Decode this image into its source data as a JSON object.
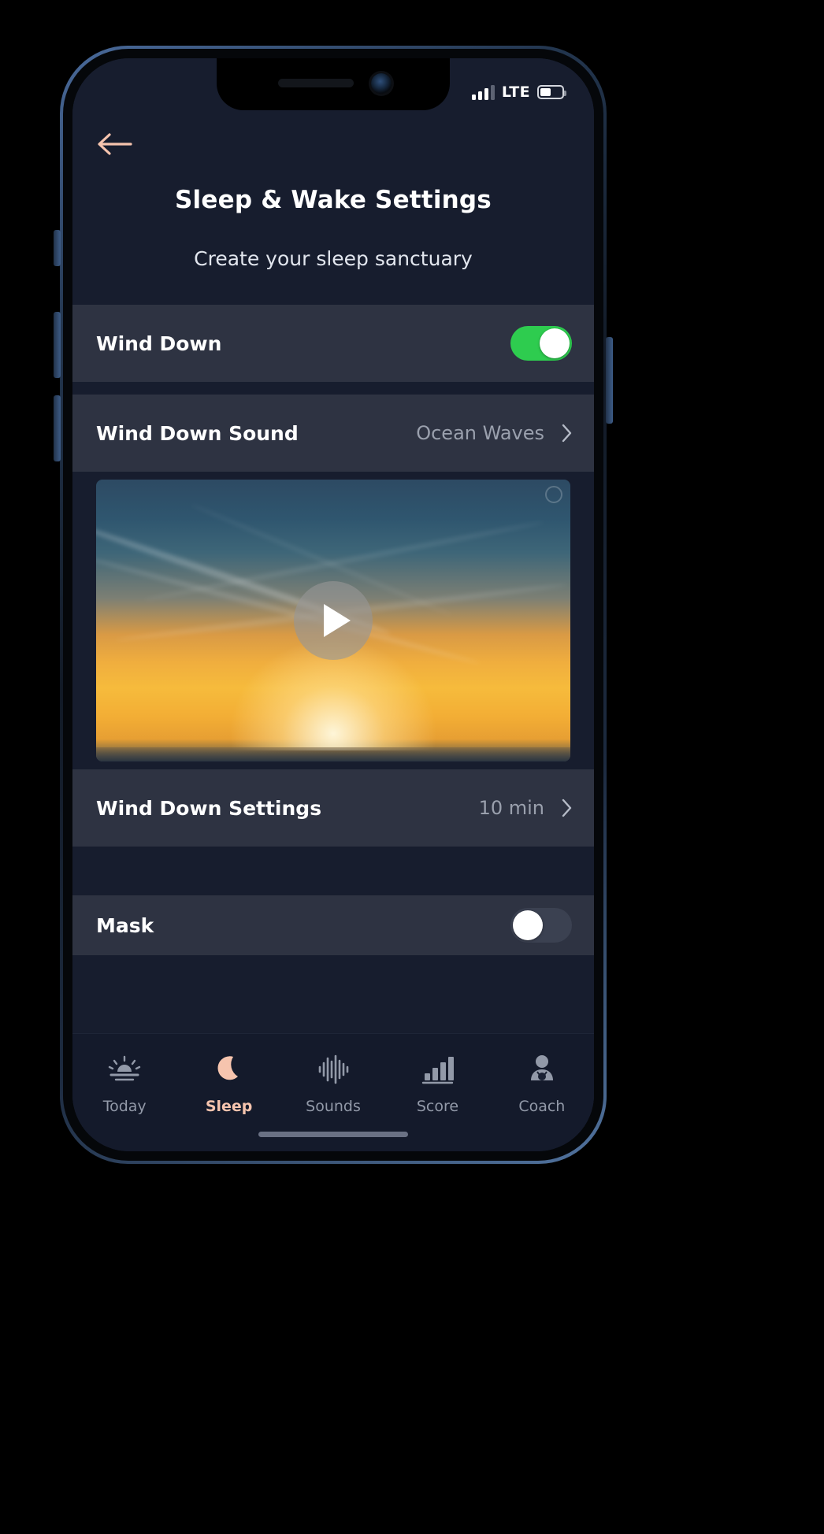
{
  "status_bar": {
    "network": "LTE",
    "signal_bars_filled": 3,
    "signal_bars_total": 4,
    "battery_percent": 50
  },
  "header": {
    "back_icon": "arrow-left-icon",
    "title": "Sleep & Wake Settings",
    "subtitle": "Create your sleep sanctuary"
  },
  "rows": {
    "wind_down": {
      "label": "Wind Down",
      "toggle_state": "on",
      "toggle_color": "#2ecc4f"
    },
    "wind_down_sound": {
      "label": "Wind Down Sound",
      "value": "Ocean Waves",
      "chevron": "chevron-right-icon"
    },
    "wind_down_settings": {
      "label": "Wind Down Settings",
      "value": "10 min",
      "chevron": "chevron-right-icon"
    },
    "mask": {
      "label": "Mask",
      "toggle_state": "off"
    }
  },
  "preview": {
    "play_icon": "play-icon",
    "description": "Sunset over ocean horizon"
  },
  "tab_bar": {
    "active": "Sleep",
    "active_color": "#f6c4ae",
    "items": [
      {
        "label": "Today",
        "icon": "sunrise-icon"
      },
      {
        "label": "Sleep",
        "icon": "moon-icon"
      },
      {
        "label": "Sounds",
        "icon": "waveform-icon"
      },
      {
        "label": "Score",
        "icon": "bar-chart-icon"
      },
      {
        "label": "Coach",
        "icon": "person-coach-icon"
      }
    ]
  },
  "theme": {
    "app_background": "#171d2e",
    "row_background": "#2e3342",
    "accent": "#f6c4ae"
  }
}
